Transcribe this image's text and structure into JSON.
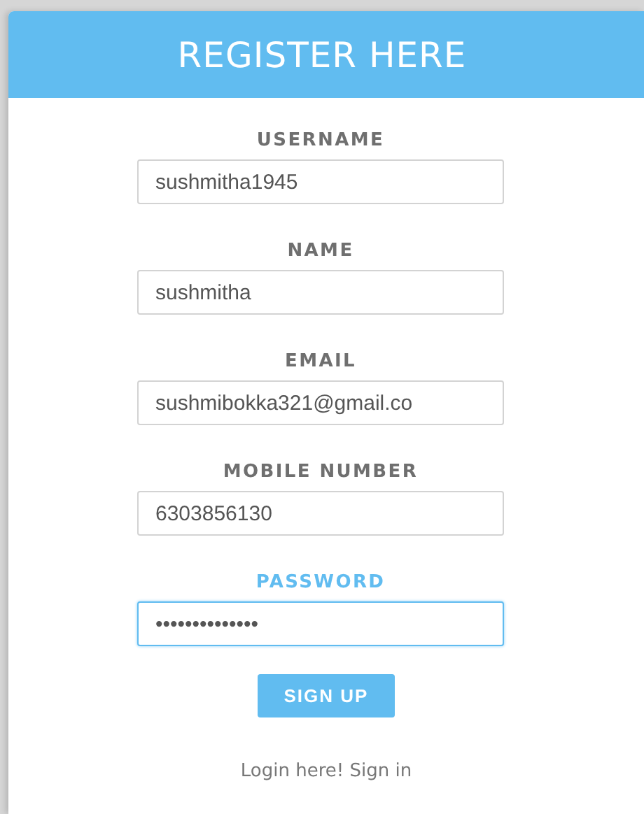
{
  "header": {
    "title": "REGISTER HERE"
  },
  "fields": [
    {
      "label": "USERNAME",
      "value": "sushmitha1945",
      "focused": false
    },
    {
      "label": "NAME",
      "value": "sushmitha",
      "focused": false
    },
    {
      "label": "EMAIL",
      "value": "sushmibokka321@gmail.co",
      "focused": false
    },
    {
      "label": "MOBILE NUMBER",
      "value": "6303856130",
      "focused": false
    },
    {
      "label": "PASSWORD",
      "value": "••••••••••••••",
      "focused": true
    }
  ],
  "submit_button": "SIGN UP",
  "footer_link": "Login here! Sign in"
}
